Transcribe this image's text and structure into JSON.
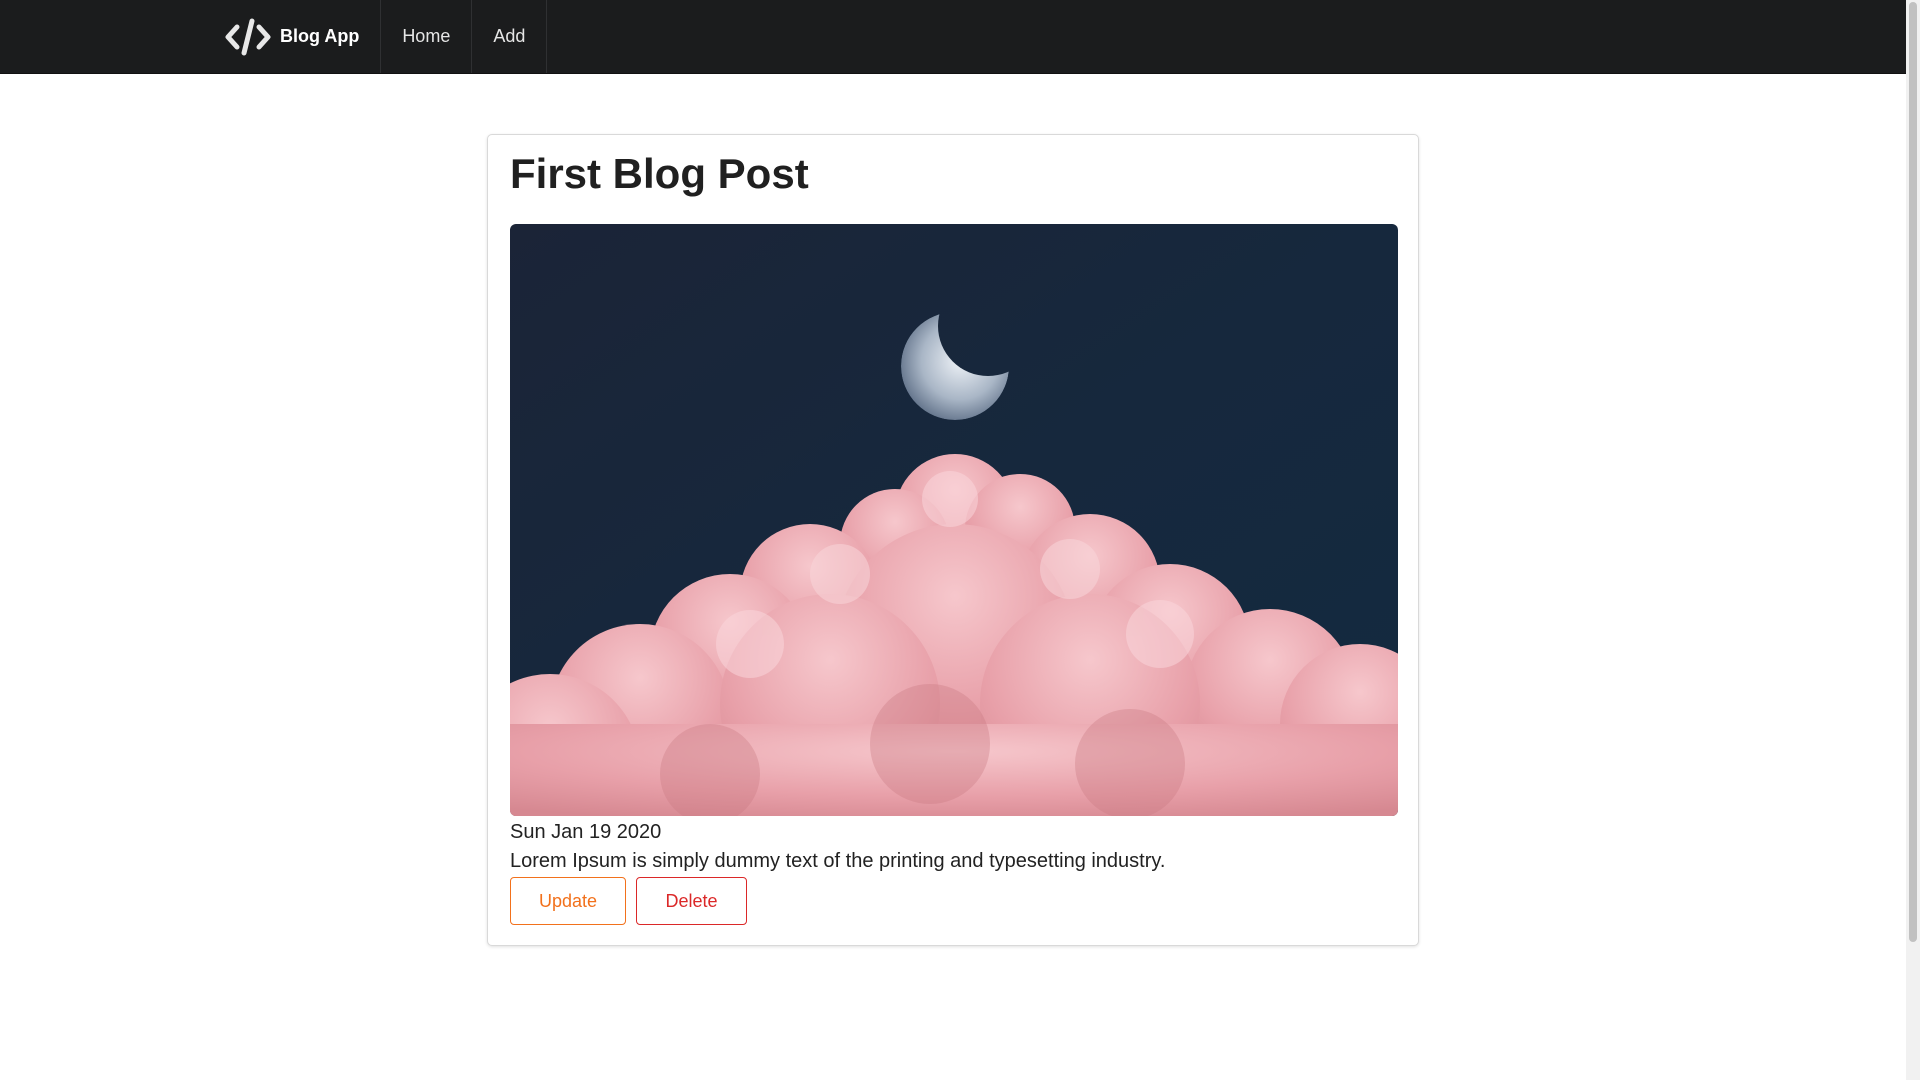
{
  "navbar": {
    "brand_label": "Blog App",
    "brand_icon": "code-icon",
    "links": [
      {
        "label": "Home"
      },
      {
        "label": "Add"
      }
    ],
    "background": "#1b1c1d"
  },
  "post": {
    "title": "First Blog Post",
    "image_alt": "Crescent moon above pink clouds",
    "date": "Sun Jan 19 2020",
    "body": "Lorem Ipsum is simply dummy text of the printing and typesetting industry.",
    "actions": {
      "update_label": "Update",
      "delete_label": "Delete"
    }
  },
  "colors": {
    "update": "#f2711c",
    "delete": "#db2828",
    "sky": "#17263a",
    "cloud": "#e9a3ab"
  }
}
